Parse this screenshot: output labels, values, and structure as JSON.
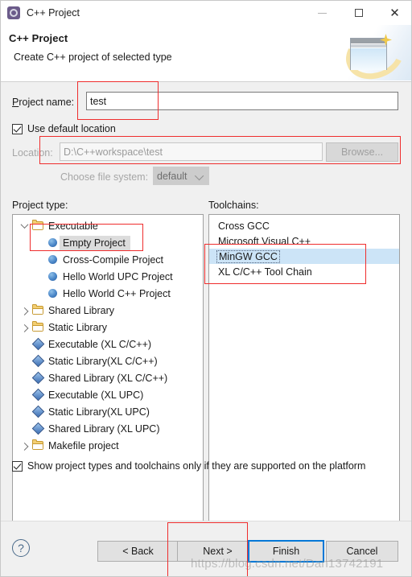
{
  "window": {
    "title": "C++ Project",
    "icon": "gear-icon",
    "controls": {
      "minimize": "minimize-icon",
      "maximize": "maximize-icon",
      "close": "close-icon"
    }
  },
  "header": {
    "title": "C++ Project",
    "subtitle": "Create C++ project of selected type",
    "banner_icon": "wizard-banner-icon"
  },
  "form": {
    "project_name_label": "Project name:",
    "project_name_value": "test",
    "use_default_location_label": "Use default location",
    "use_default_location_checked": true,
    "location_label": "Location:",
    "location_value": "D:\\C++workspace\\test",
    "browse_label": "Browse...",
    "file_system_label": "Choose file system:",
    "file_system_value": "default"
  },
  "project_type": {
    "label": "Project type:",
    "items": [
      {
        "text": "Executable",
        "icon": "folder-icon",
        "indent": 0,
        "twisty": "down",
        "selected": false
      },
      {
        "text": "Empty Project",
        "icon": "ball-icon",
        "indent": 1,
        "twisty": "none",
        "selected": true
      },
      {
        "text": "Cross-Compile Project",
        "icon": "ball-icon",
        "indent": 1,
        "twisty": "none",
        "selected": false
      },
      {
        "text": "Hello World UPC Project",
        "icon": "ball-icon",
        "indent": 1,
        "twisty": "none",
        "selected": false
      },
      {
        "text": "Hello World C++ Project",
        "icon": "ball-icon",
        "indent": 1,
        "twisty": "none",
        "selected": false
      },
      {
        "text": "Shared Library",
        "icon": "folder-icon",
        "indent": 0,
        "twisty": "right",
        "selected": false
      },
      {
        "text": "Static Library",
        "icon": "folder-icon",
        "indent": 0,
        "twisty": "right",
        "selected": false
      },
      {
        "text": "Executable (XL C/C++)",
        "icon": "diamond-icon",
        "indent": 0,
        "twisty": "none",
        "selected": false
      },
      {
        "text": "Static Library(XL C/C++)",
        "icon": "diamond-icon",
        "indent": 0,
        "twisty": "none",
        "selected": false
      },
      {
        "text": "Shared Library (XL C/C++)",
        "icon": "diamond-icon",
        "indent": 0,
        "twisty": "none",
        "selected": false
      },
      {
        "text": "Executable (XL UPC)",
        "icon": "diamond-icon",
        "indent": 0,
        "twisty": "none",
        "selected": false
      },
      {
        "text": "Static Library(XL UPC)",
        "icon": "diamond-icon",
        "indent": 0,
        "twisty": "none",
        "selected": false
      },
      {
        "text": "Shared Library (XL UPC)",
        "icon": "diamond-icon",
        "indent": 0,
        "twisty": "none",
        "selected": false
      },
      {
        "text": "Makefile project",
        "icon": "folder-icon",
        "indent": 0,
        "twisty": "right",
        "selected": false
      }
    ]
  },
  "toolchains": {
    "label": "Toolchains:",
    "items": [
      {
        "text": "Cross GCC",
        "selected": false
      },
      {
        "text": "Microsoft Visual C++",
        "selected": false
      },
      {
        "text": "MinGW GCC",
        "selected": true
      },
      {
        "text": "XL C/C++ Tool Chain",
        "selected": false
      }
    ]
  },
  "show_supported": {
    "label": "Show project types and toolchains only if they are supported on the platform",
    "checked": true
  },
  "footer": {
    "help_glyph": "?",
    "back_label": "< Back",
    "next_label": "Next >",
    "finish_label": "Finish",
    "cancel_label": "Cancel"
  },
  "watermark": "https://blog.csdn.net/Dan13742191",
  "colors": {
    "annotation": "#ef2d2d",
    "default_button_border": "#0078d7",
    "list_selection": "#cce4f7",
    "tree_selection": "#dcdcdc"
  }
}
